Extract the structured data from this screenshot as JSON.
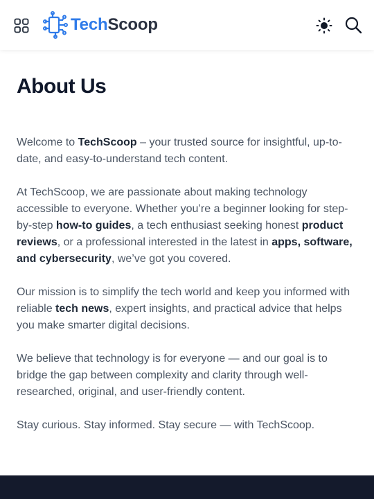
{
  "header": {
    "brand": {
      "part1": "Tech",
      "part2": "Scoop"
    },
    "icons": {
      "menu": "grid-icon",
      "theme": "sun-icon",
      "search": "search-icon"
    },
    "colors": {
      "brand_blue": "#2f7be9",
      "brand_dark": "#2a3140"
    }
  },
  "page": {
    "title": "About Us",
    "p1": {
      "a": "Welcome to ",
      "b": "TechScoop",
      "c": " – your trusted source for insightful, up-to-date, and easy-to-understand tech content."
    },
    "p2": {
      "a": "At TechScoop, we are passionate about making technology accessible to everyone. Whether you’re a beginner looking for step-by-step ",
      "b": "how-to guides",
      "c": ", a tech enthusiast seeking honest ",
      "d": "product reviews",
      "e": ", or a professional interested in the latest in ",
      "f": "apps, software, and cybersecurity",
      "g": ", we’ve got you covered."
    },
    "p3": {
      "a": "Our mission is to simplify the tech world and keep you informed with reliable ",
      "b": "tech news",
      "c": ", expert insights, and practical advice that helps you make smarter digital decisions."
    },
    "p4": "We believe that technology is for everyone — and our goal is to bridge the gap between complexity and clarity through well-researched, original, and user-friendly content.",
    "p5": "Stay curious. Stay informed. Stay secure — with TechScoop."
  },
  "footer": {
    "color": "#141a2c"
  }
}
